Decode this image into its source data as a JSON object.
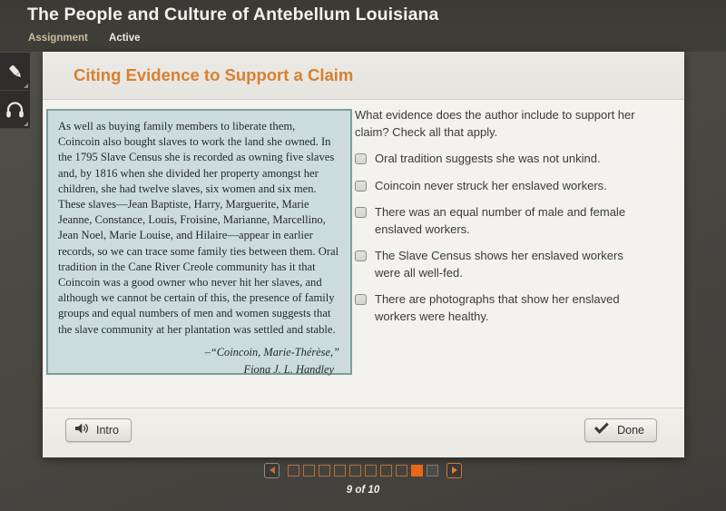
{
  "header": {
    "title": "The People and Culture of Antebellum Louisiana",
    "assignment_label": "Assignment",
    "status_label": "Active"
  },
  "tool_rail": {
    "items": [
      {
        "icon": "highlighter-icon",
        "name": "highlighter-tool"
      },
      {
        "icon": "headphones-icon",
        "name": "audio-tool"
      }
    ]
  },
  "lesson": {
    "title": "Citing Evidence to Support a Claim"
  },
  "passage": {
    "text": "As well as buying family members to liberate them, Coincoin also bought slaves to work the land she owned. In the 1795 Slave Census she is recorded as owning five slaves and, by 1816 when she divided her property amongst her children, she had twelve slaves, six women and six men. These slaves—Jean Baptiste, Harry, Marguerite, Marie Jeanne, Constance, Louis, Froisine, Marianne, Marcellino, Jean Noel, Marie Louise, and Hilaire—appear in earlier records, so we can trace some family ties between them. Oral tradition in the Cane River Creole community has it that Coincoin was a good owner who never hit her slaves, and although we cannot be certain of this, the presence of family groups and equal numbers of men and women suggests that the slave community at her plantation was settled and stable.",
    "source": "–“Coincoin, Marie-Thérèse,”",
    "author": "Fiona J. L. Handley"
  },
  "question": {
    "prompt": "What evidence does the author include to support her claim? Check all that apply.",
    "options": [
      {
        "label": "Oral tradition suggests she was not unkind.",
        "checked": false
      },
      {
        "label": "Coincoin never struck her enslaved workers.",
        "checked": false
      },
      {
        "label": "There was an equal number of male and female enslaved workers.",
        "checked": false
      },
      {
        "label": "The Slave Census shows her enslaved workers were all well-fed.",
        "checked": false
      },
      {
        "label": "There are photographs that show her enslaved workers were healthy.",
        "checked": false
      }
    ]
  },
  "footer": {
    "intro_label": "Intro",
    "intro_icon": "speaker-icon",
    "done_label": "Done",
    "done_icon": "checkmark-icon"
  },
  "pager": {
    "prev_icon": "triangle-left-icon",
    "next_icon": "triangle-right-icon",
    "label": "9 of 10",
    "current": 9,
    "total": 10,
    "dots": [
      {
        "state": "visited"
      },
      {
        "state": "visited"
      },
      {
        "state": "visited"
      },
      {
        "state": "visited"
      },
      {
        "state": "visited"
      },
      {
        "state": "visited"
      },
      {
        "state": "visited"
      },
      {
        "state": "visited"
      },
      {
        "state": "current"
      },
      {
        "state": "unvisited"
      }
    ]
  },
  "colors": {
    "accent_orange": "#d8802f",
    "current_page": "#e8671b",
    "passage_fill": "#ccdcdc",
    "passage_border": "#7d9d9d",
    "app_chrome": "#3b3a36",
    "assignment_label": "#cdbc9a"
  }
}
